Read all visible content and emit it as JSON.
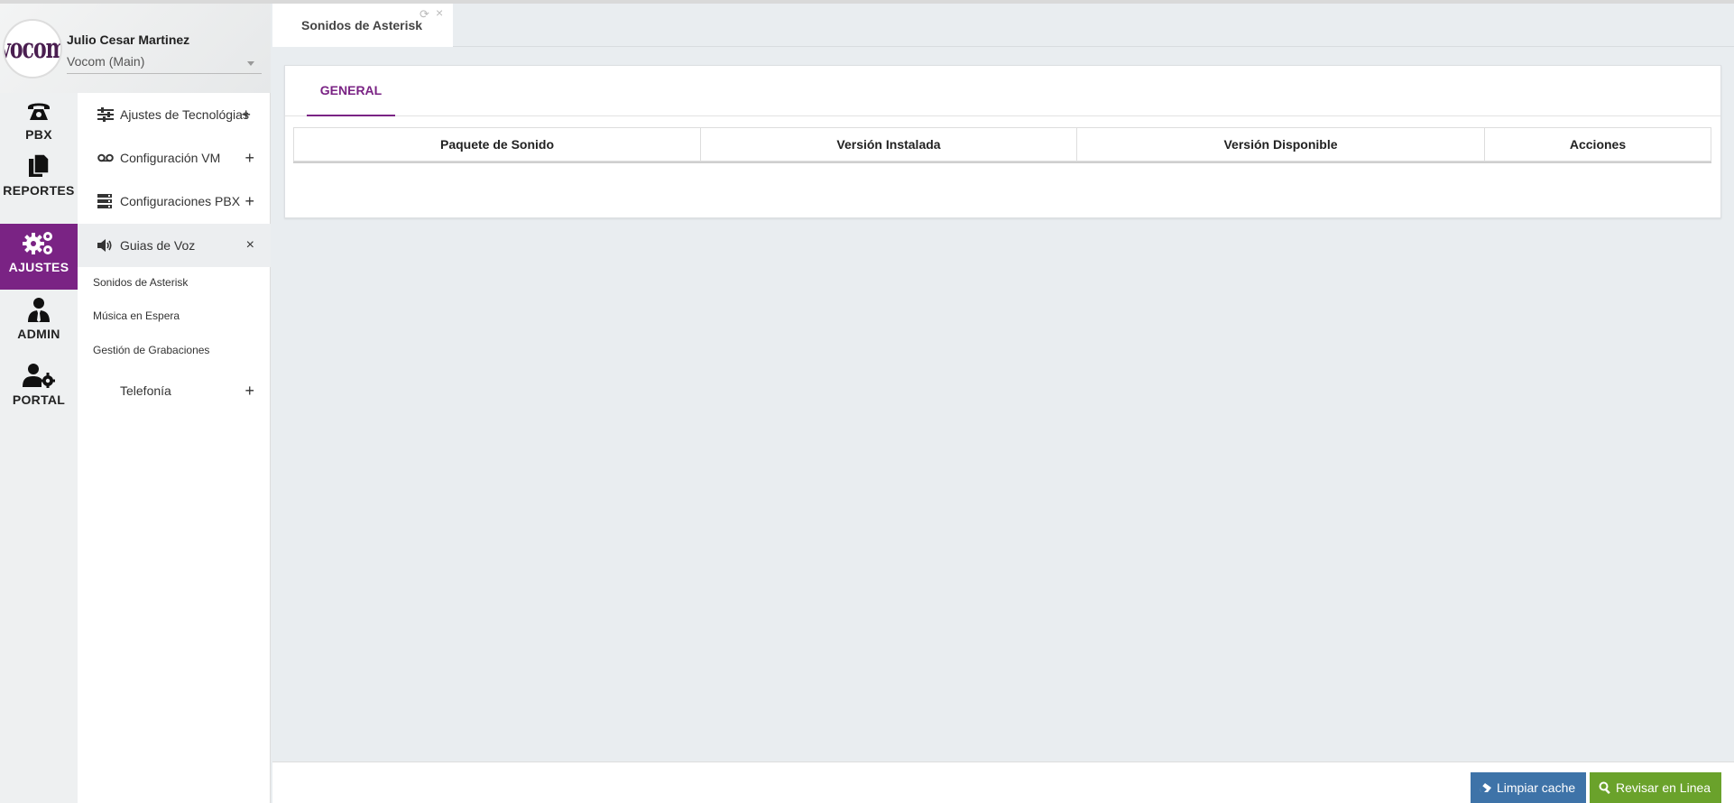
{
  "user": {
    "avatar_text": "vocom",
    "name": "Julio Cesar Martinez",
    "organization": "Vocom (Main)"
  },
  "rail": [
    {
      "label": "PBX",
      "icon": "phone-icon",
      "active": false
    },
    {
      "label": "REPORTES",
      "icon": "documents-icon",
      "active": false
    },
    {
      "label": "AJUSTES",
      "icon": "gears-icon",
      "active": true
    },
    {
      "label": "ADMIN",
      "icon": "user-tie-icon",
      "active": false
    },
    {
      "label": "PORTAL",
      "icon": "user-gear-icon",
      "active": false
    }
  ],
  "menu": {
    "items": [
      {
        "label": "Ajustes de Tecnológias",
        "icon": "sliders-icon",
        "toggle": "+"
      },
      {
        "label": "Configuración VM",
        "icon": "voicemail-icon",
        "toggle": "+"
      },
      {
        "label": "Configuraciones PBX",
        "icon": "server-icon",
        "toggle": "+"
      },
      {
        "label": "Guias de Voz",
        "icon": "volume-icon",
        "toggle": "×"
      },
      {
        "label": "Telefonía",
        "icon": "",
        "toggle": "+"
      }
    ],
    "subitems": [
      "Sonidos de Asterisk",
      "Música en Espera",
      "Gestión de Grabaciones"
    ]
  },
  "tabbar": {
    "active_tab": "Sonidos de Asterisk"
  },
  "card": {
    "tab": "GENERAL",
    "columns": [
      "Paquete de Sonido",
      "Versión Instalada",
      "Versión Disponible",
      "Acciones"
    ]
  },
  "footer": {
    "clear_cache": "Limpiar cache",
    "check_online": "Revisar en Linea"
  },
  "colors": {
    "accent": "#7a2384",
    "blue_button": "#3e73a8",
    "green_button": "#6aa22b"
  }
}
